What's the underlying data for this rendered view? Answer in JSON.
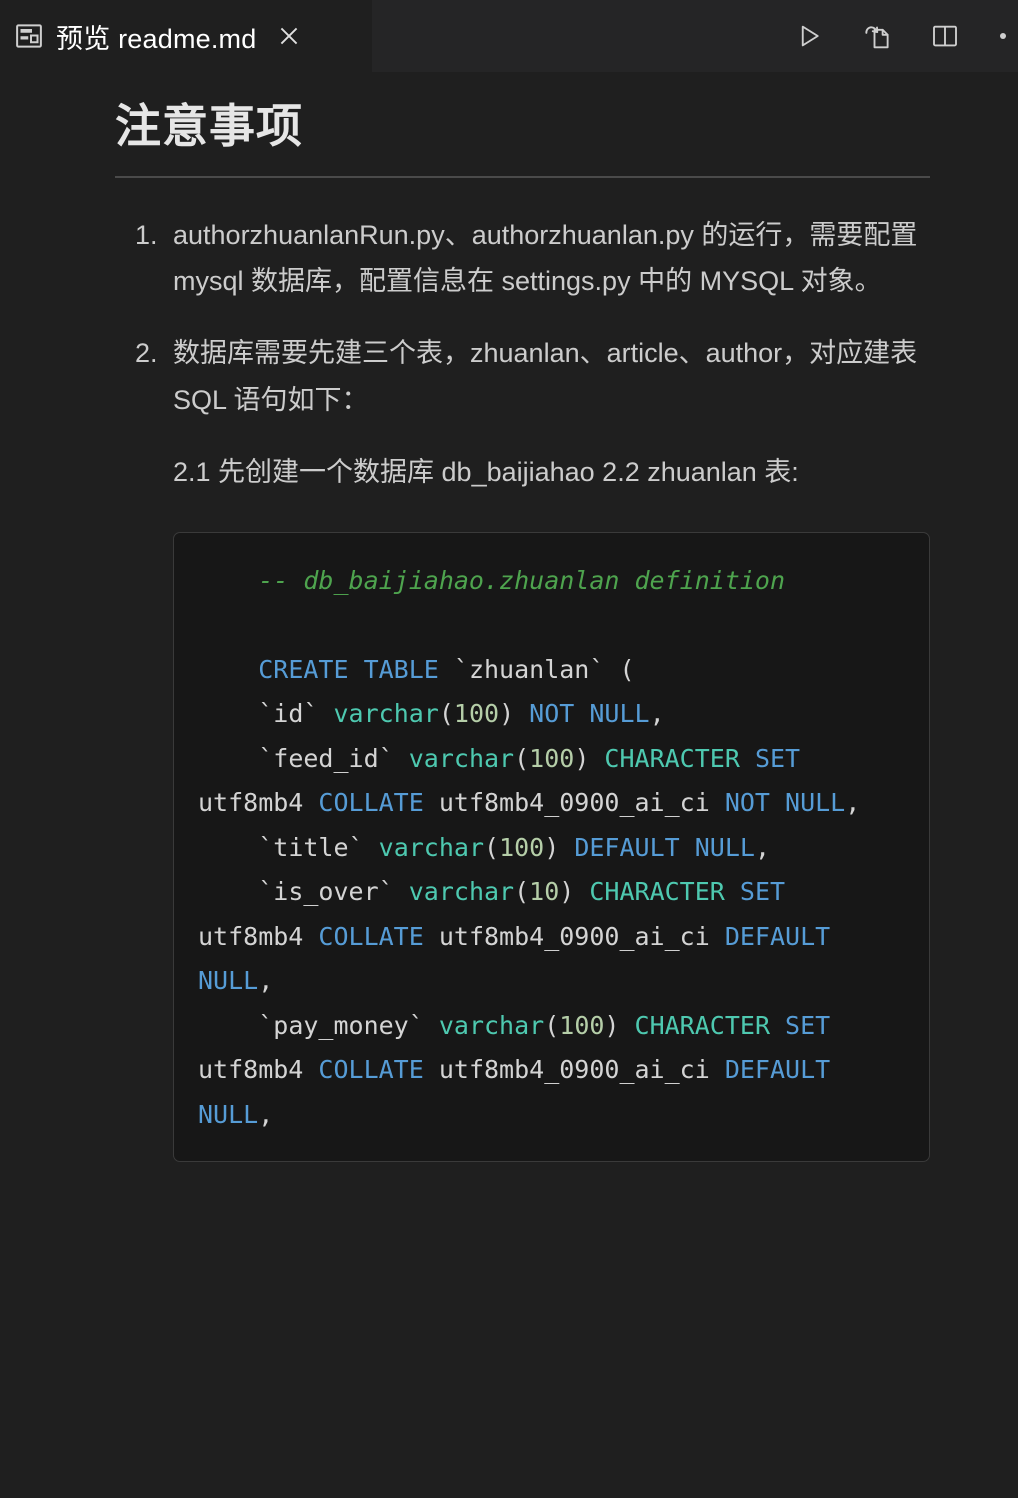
{
  "tab": {
    "icon": "preview-pane-icon",
    "label": "预览 readme.md",
    "close_icon": "close-icon"
  },
  "toolbar": {
    "run_label": "run-icon",
    "open_to_side_label": "export-file-icon",
    "split_editor_label": "split-editor-icon",
    "more_label": "more-actions-icon"
  },
  "document": {
    "title": "注意事项",
    "list": [
      {
        "text": "authorzhuanlanRun.py、authorzhuanlan.py 的运行，需要配置 mysql 数据库，配置信息在 settings.py 中的 MYSQL 对象。"
      },
      {
        "text": "数据库需要先建三个表，zhuanlan、article、author，对应建表 SQL 语句如下：",
        "sub_paragraph": "2.1 先创建一个数据库 db_baijiahao 2.2 zhuanlan 表:"
      }
    ],
    "code": {
      "language": "sql",
      "tokens": [
        {
          "t": "    -- db_baijiahao.zhuanlan definition\n\n",
          "c": "comment"
        },
        {
          "t": "    CREATE TABLE ",
          "c": "keyword"
        },
        {
          "t": "`zhuanlan` (\n    `id` ",
          "c": "ident"
        },
        {
          "t": "varchar",
          "c": "type"
        },
        {
          "t": "(",
          "c": "plain"
        },
        {
          "t": "100",
          "c": "number"
        },
        {
          "t": ") ",
          "c": "plain"
        },
        {
          "t": "NOT NULL",
          "c": "keyword"
        },
        {
          "t": ",\n    `feed_id` ",
          "c": "ident"
        },
        {
          "t": "varchar",
          "c": "type"
        },
        {
          "t": "(",
          "c": "plain"
        },
        {
          "t": "100",
          "c": "number"
        },
        {
          "t": ") ",
          "c": "plain"
        },
        {
          "t": "CHARACTER ",
          "c": "type"
        },
        {
          "t": "SET ",
          "c": "keyword"
        },
        {
          "t": "utf8mb4 ",
          "c": "plain"
        },
        {
          "t": "COLLATE ",
          "c": "keyword"
        },
        {
          "t": "utf8mb4_0900_ai_ci ",
          "c": "plain"
        },
        {
          "t": "NOT NULL",
          "c": "keyword"
        },
        {
          "t": ",\n    `title` ",
          "c": "ident"
        },
        {
          "t": "varchar",
          "c": "type"
        },
        {
          "t": "(",
          "c": "plain"
        },
        {
          "t": "100",
          "c": "number"
        },
        {
          "t": ") ",
          "c": "plain"
        },
        {
          "t": "DEFAULT NULL",
          "c": "keyword"
        },
        {
          "t": ",\n    `is_over` ",
          "c": "ident"
        },
        {
          "t": "varchar",
          "c": "type"
        },
        {
          "t": "(",
          "c": "plain"
        },
        {
          "t": "10",
          "c": "number"
        },
        {
          "t": ") ",
          "c": "plain"
        },
        {
          "t": "CHARACTER ",
          "c": "type"
        },
        {
          "t": "SET ",
          "c": "keyword"
        },
        {
          "t": "utf8mb4 ",
          "c": "plain"
        },
        {
          "t": "COLLATE ",
          "c": "keyword"
        },
        {
          "t": "utf8mb4_0900_ai_ci ",
          "c": "plain"
        },
        {
          "t": "DEFAULT NULL",
          "c": "keyword"
        },
        {
          "t": ",\n    `pay_money` ",
          "c": "ident"
        },
        {
          "t": "varchar",
          "c": "type"
        },
        {
          "t": "(",
          "c": "plain"
        },
        {
          "t": "100",
          "c": "number"
        },
        {
          "t": ") ",
          "c": "plain"
        },
        {
          "t": "CHARACTER ",
          "c": "type"
        },
        {
          "t": "SET ",
          "c": "keyword"
        },
        {
          "t": "utf8mb4 ",
          "c": "plain"
        },
        {
          "t": "COLLATE ",
          "c": "keyword"
        },
        {
          "t": "utf8mb4_0900_ai_ci ",
          "c": "plain"
        },
        {
          "t": "DEFAULT NULL",
          "c": "keyword"
        },
        {
          "t": ",",
          "c": "ident"
        }
      ]
    }
  },
  "colors": {
    "page_background": "#1f1f1f",
    "tabbar_background": "#252526",
    "code_background": "#171717",
    "code_border": "#3a3a3a",
    "body_text": "#cccccc",
    "heading_text": "#e6e6e6",
    "rule": "#4a4a4a",
    "syntax_comment": "#4ea44e",
    "syntax_keyword": "#569cd6",
    "syntax_type": "#4ec9b0",
    "syntax_number": "#b5cea8",
    "syntax_plain": "#d4d4d4"
  }
}
